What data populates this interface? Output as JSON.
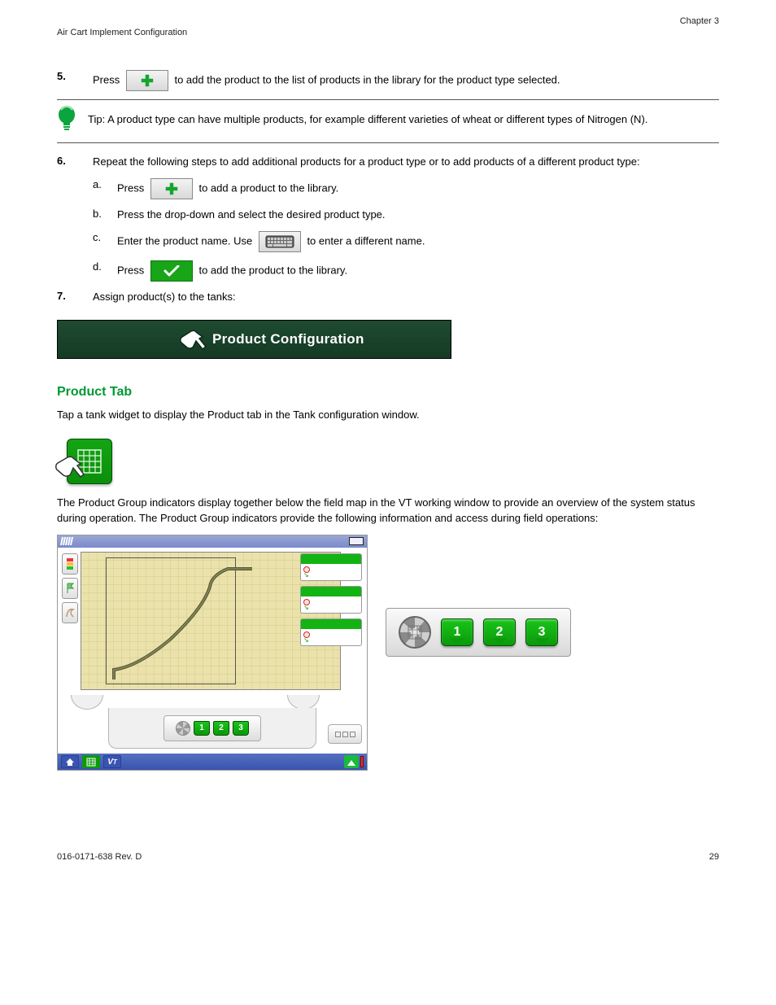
{
  "header": {
    "right": "Chapter 3",
    "left": "Air Cart Implement Configuration"
  },
  "steps_a": {
    "s5": {
      "num": "5.",
      "pre": "Press ",
      "post": " to add the product to the list of products in the library for the product type selected."
    },
    "tip": "Tip: A product type can have multiple products, for example different varieties of wheat or different types of Nitrogen (N).",
    "s6": {
      "num": "6.",
      "text": "Repeat the following steps to add additional products for a product type or to add products of a different product type:"
    },
    "s6a": {
      "num": "a.",
      "pre": "Press ",
      "post": " to add a product to the library."
    },
    "s6b": {
      "num": "b.",
      "text": "Press the drop-down and select the desired product type."
    },
    "s6c": {
      "num": "c.",
      "pre": "Enter the product name. Use ",
      "post": " to enter a different name."
    },
    "s6d": {
      "num": "d.",
      "pre": "Press ",
      "post": " to add the product to the library."
    },
    "s7": {
      "num": "7.",
      "text": "Assign product(s) to the tanks:"
    },
    "banner": "Product Configuration"
  },
  "section_title": "Product Tab",
  "product_tab_text": "Tap a tank widget to display the Product tab in the Tank configuration window.",
  "product_group_intro": "The Product Group indicators display together below the field map in the VT working window to provide an overview of the system status during operation. The Product Group indicators provide the following information and access during field operations:",
  "panel_tags": {
    "t1": "1",
    "t2": "2",
    "t3": "3"
  },
  "footer": {
    "pn": "016-0171-638 Rev. D",
    "page": "29"
  }
}
